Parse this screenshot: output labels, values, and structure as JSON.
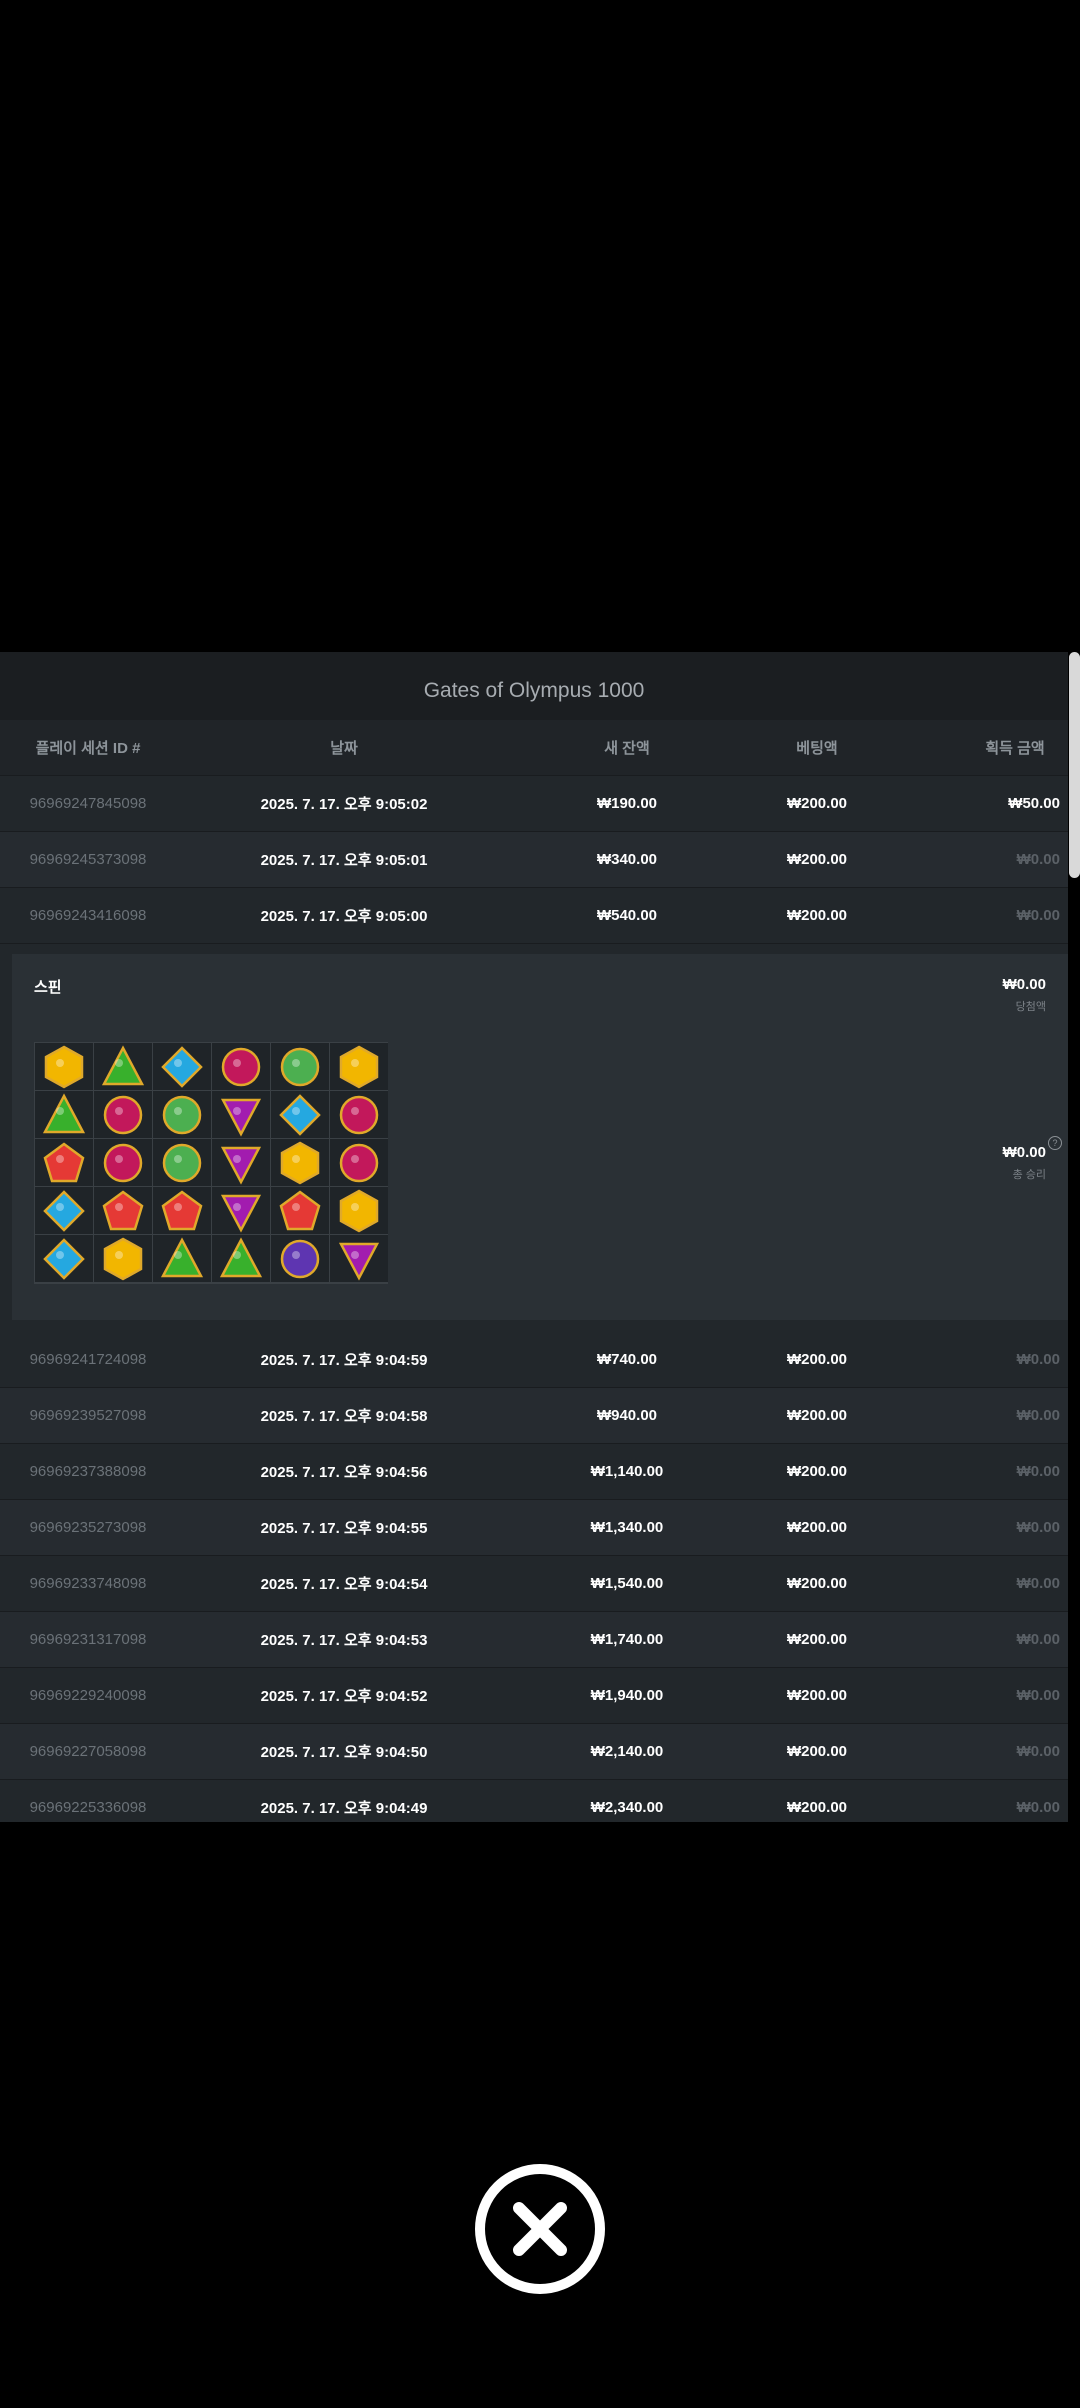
{
  "title": "Gates of Olympus 1000",
  "columns": [
    "플레이 세션 ID #",
    "날짜",
    "새 잔액",
    "베팅액",
    "획득 금액"
  ],
  "rows_top": [
    {
      "id": "96969247845098",
      "date": "2025. 7. 17. 오후 9:05:02",
      "balance": "₩190.00",
      "bet": "₩200.00",
      "win": "₩50.00",
      "zero": false
    },
    {
      "id": "96969245373098",
      "date": "2025. 7. 17. 오후 9:05:01",
      "balance": "₩340.00",
      "bet": "₩200.00",
      "win": "₩0.00",
      "zero": true
    },
    {
      "id": "96969243416098",
      "date": "2025. 7. 17. 오후 9:05:00",
      "balance": "₩540.00",
      "bet": "₩200.00",
      "win": "₩0.00",
      "zero": true
    }
  ],
  "detail": {
    "spin_label": "스핀",
    "win_amount": "₩0.00",
    "win_label": "당첨액",
    "total_amount": "₩0.00",
    "total_label": "총 승리",
    "help": "?",
    "grid": [
      [
        "yellow-hex",
        "green-tri",
        "blue-diamond",
        "red-ring",
        "green-ring",
        "yellow-hex"
      ],
      [
        "green-tri",
        "red-ring",
        "green-ring",
        "purple-tri",
        "blue-diamond",
        "red-ring"
      ],
      [
        "red-pent",
        "red-ring",
        "green-ring",
        "purple-tri",
        "yellow-hex",
        "red-ring"
      ],
      [
        "blue-diamond",
        "red-pent",
        "red-pent",
        "purple-tri",
        "red-pent",
        "yellow-hex"
      ],
      [
        "blue-diamond",
        "yellow-hex",
        "green-tri",
        "green-tri",
        "purple-ring",
        "purple-tri"
      ]
    ]
  },
  "rows_bottom": [
    {
      "id": "96969241724098",
      "date": "2025. 7. 17. 오후 9:04:59",
      "balance": "₩740.00",
      "bet": "₩200.00",
      "win": "₩0.00",
      "zero": true
    },
    {
      "id": "96969239527098",
      "date": "2025. 7. 17. 오후 9:04:58",
      "balance": "₩940.00",
      "bet": "₩200.00",
      "win": "₩0.00",
      "zero": true
    },
    {
      "id": "96969237388098",
      "date": "2025. 7. 17. 오후 9:04:56",
      "balance": "₩1,140.00",
      "bet": "₩200.00",
      "win": "₩0.00",
      "zero": true
    },
    {
      "id": "96969235273098",
      "date": "2025. 7. 17. 오후 9:04:55",
      "balance": "₩1,340.00",
      "bet": "₩200.00",
      "win": "₩0.00",
      "zero": true
    },
    {
      "id": "96969233748098",
      "date": "2025. 7. 17. 오후 9:04:54",
      "balance": "₩1,540.00",
      "bet": "₩200.00",
      "win": "₩0.00",
      "zero": true
    },
    {
      "id": "96969231317098",
      "date": "2025. 7. 17. 오후 9:04:53",
      "balance": "₩1,740.00",
      "bet": "₩200.00",
      "win": "₩0.00",
      "zero": true
    },
    {
      "id": "96969229240098",
      "date": "2025. 7. 17. 오후 9:04:52",
      "balance": "₩1,940.00",
      "bet": "₩200.00",
      "win": "₩0.00",
      "zero": true
    },
    {
      "id": "96969227058098",
      "date": "2025. 7. 17. 오후 9:04:50",
      "balance": "₩2,140.00",
      "bet": "₩200.00",
      "win": "₩0.00",
      "zero": true
    },
    {
      "id": "96969225336098",
      "date": "2025. 7. 17. 오후 9:04:49",
      "balance": "₩2,340.00",
      "bet": "₩200.00",
      "win": "₩0.00",
      "zero": true
    }
  ],
  "colors": {
    "yellow-hex": "#f2b600",
    "green-tri": "#38b02c",
    "blue-diamond": "#25a8e0",
    "red-ring": "#c2185b",
    "green-ring": "#4caf50",
    "purple-tri": "#a21caf",
    "red-pent": "#e53935",
    "purple-ring": "#5e35b1"
  }
}
